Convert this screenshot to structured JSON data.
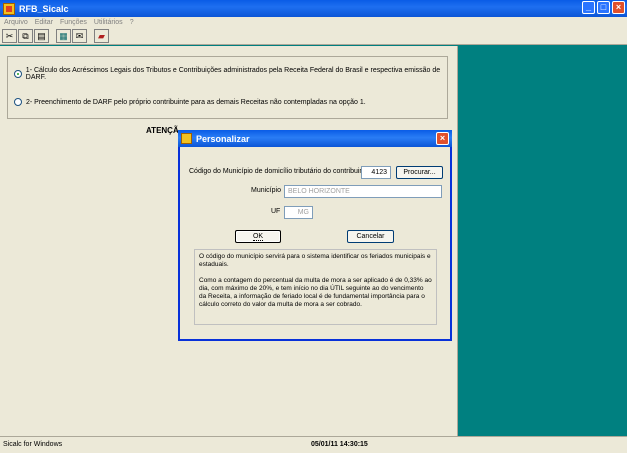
{
  "window": {
    "title": "RFB_Sicalc",
    "controls": {
      "minimize": "_",
      "maximize": "□",
      "close": "×"
    }
  },
  "menu": [
    "Arquivo",
    "Editar",
    "Funções",
    "Utilitários",
    "?"
  ],
  "toolbar": {
    "icons": [
      "cut-icon",
      "copy-icon",
      "paste-icon",
      "calculator-icon",
      "mail-icon",
      "book-icon"
    ]
  },
  "options": [
    {
      "label": "1- Cálculo dos Acréscimos Legais dos Tributos e Contribuições administrados pela Receita Federal do Brasil  e respectiva emissão de DARF.",
      "selected": true
    },
    {
      "label": "2- Preenchimento de DARF pelo próprio contribuinte para as demais Receitas não contempladas na opção 1.",
      "selected": false
    }
  ],
  "atencao": "ATENÇÃ",
  "dialog": {
    "title": "Personalizar",
    "close": "×",
    "codigo_label": "Código do Município de domicílio tributário do contribuinte",
    "codigo_value": "4123",
    "procurar_label": "Procurar...",
    "municipio_label": "Município",
    "municipio_value": "BELO HORIZONTE",
    "uf_label": "UF",
    "uf_value": "MG",
    "ok_label": "OK",
    "cancel_label": "Cancelar",
    "info_p1": "O código do município servirá para o sistema identificar os feriados municipais e estaduais.",
    "info_p2": "Como a contagem do percentual da multa de mora a ser aplicado é de 0,33% ao dia, com máximo de 20%, e tem início no dia ÚTIL seguinte ao do vencimento da Receita, a informação de feriado local é de fundamental importância para o cálculo correto do valor da multa de mora a ser cobrado."
  },
  "status": {
    "left": "Sicalc for Windows",
    "datetime": "05/01/11  14:30:15"
  }
}
